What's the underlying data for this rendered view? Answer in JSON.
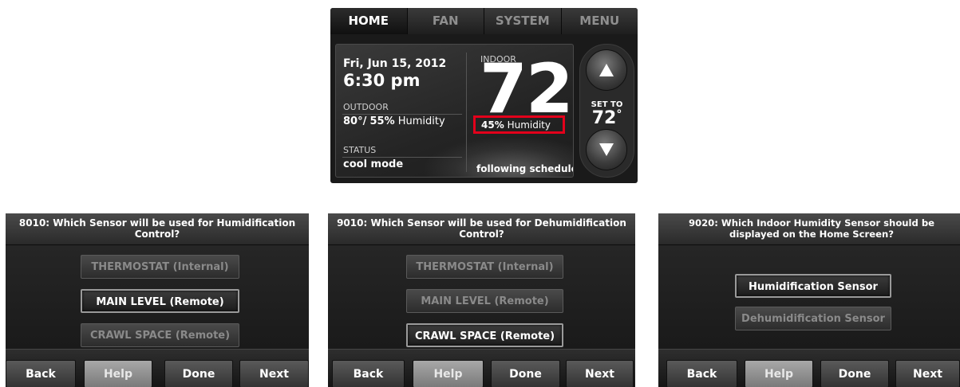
{
  "home": {
    "tabs": [
      "HOME",
      "FAN",
      "SYSTEM",
      "MENU"
    ],
    "date": "Fri, Jun 15, 2012",
    "time": "6:30 pm",
    "outdoor_label": "OUTDOOR",
    "outdoor_temp": "80°/",
    "outdoor_humidity": "55%",
    "outdoor_humidity_word": "Humidity",
    "status_label": "STATUS",
    "status_value": "cool mode",
    "indoor_label": "INDOOR",
    "indoor_temp": "72",
    "indoor_deg": "°",
    "indoor_humidity": "45%",
    "indoor_humidity_word": "Humidity",
    "schedule_text": "following schedule",
    "set_to_label": "SET TO",
    "set_to_value": "72",
    "set_to_deg": "°",
    "up_icon": "triangle-up-icon",
    "down_icon": "triangle-down-icon",
    "highlight_color": "#e3001b"
  },
  "screens": [
    {
      "title": "8010: Which Sensor will be used for Humidification Control?",
      "options": [
        "THERMOSTAT (Internal)",
        "MAIN LEVEL (Remote)",
        "CRAWL SPACE (Remote)"
      ],
      "selected_index": 1,
      "buttons": [
        "Back",
        "Help",
        "Done",
        "Next"
      ]
    },
    {
      "title": "9010: Which Sensor will be used for Dehumidification Control?",
      "options": [
        "THERMOSTAT (Internal)",
        "MAIN LEVEL (Remote)",
        "CRAWL SPACE (Remote)"
      ],
      "selected_index": 2,
      "buttons": [
        "Back",
        "Help",
        "Done",
        "Next"
      ]
    },
    {
      "title": "9020: Which Indoor Humidity Sensor should be displayed on the Home Screen?",
      "options": [
        "Humidification Sensor",
        "Dehumidification Sensor"
      ],
      "selected_index": 0,
      "buttons": [
        "Back",
        "Help",
        "Done",
        "Next"
      ]
    }
  ]
}
